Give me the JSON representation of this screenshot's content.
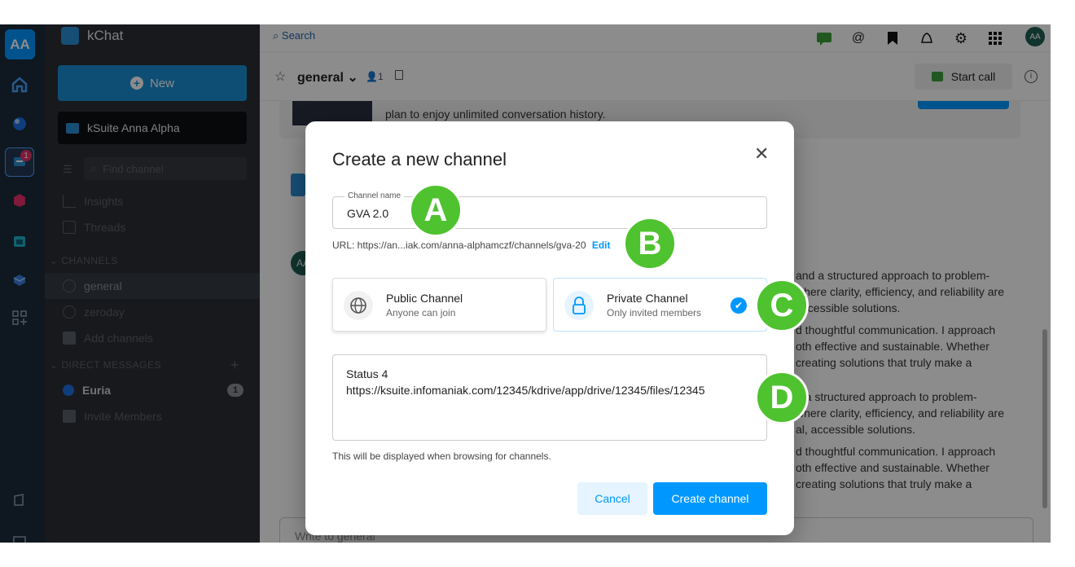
{
  "rail": {
    "avatar": "AA",
    "kchat_badge": "1"
  },
  "sidebar": {
    "app_name": "kChat",
    "new_label": "New",
    "workspace": "kSuite Anna Alpha",
    "find_placeholder": "Find channel",
    "insights": "Insights",
    "threads": "Threads",
    "channels_header": "CHANNELS",
    "channels": [
      "general",
      "zeroday"
    ],
    "add_channels": "Add channels",
    "dm_header": "DIRECT MESSAGES",
    "dm_user": "Euria",
    "dm_badge": "1",
    "invite": "Invite Members"
  },
  "header": {
    "search_placeholder": "Search",
    "avatar": "AA",
    "channel": "general",
    "member_count": "1",
    "start_call": "Start call"
  },
  "main": {
    "banner_text": "plan to enjoy unlimited conversation history.",
    "msg_avatar": "AA",
    "lines": [
      "and a structured approach to problem-",
      "where clarity, efficiency, and reliability are",
      "accessible solutions.",
      "d thoughtful communication. I approach",
      "oth effective and sustainable. Whether",
      "creating solutions that truly make a",
      "d a structured approach to problem-",
      "where clarity, efficiency, and reliability are",
      "al, accessible solutions.",
      "d thoughtful communication. I approach",
      "oth effective and sustainable. Whether",
      "creating solutions that truly make a"
    ],
    "composer_placeholder": "Write to general"
  },
  "modal": {
    "title": "Create a new channel",
    "name_label": "Channel name",
    "name_value": "GVA 2.0",
    "url_text": "URL: https://an...iak.com/anna-alphamczf/channels/gva-20",
    "url_edit": "Edit",
    "public_title": "Public Channel",
    "public_sub": "Anyone can join",
    "private_title": "Private Channel",
    "private_sub": "Only invited members",
    "purpose_line1": "Status 4",
    "purpose_line2": "https://ksuite.infomaniak.com/12345/kdrive/app/drive/12345/files/12345",
    "helper": "This will be displayed when browsing for channels.",
    "cancel": "Cancel",
    "create": "Create channel"
  },
  "callouts": [
    "A",
    "B",
    "C",
    "D"
  ],
  "colors": {
    "accent": "#0098ff",
    "callout": "#4fc22f",
    "sidebar": "#2b2f36",
    "rail": "#1d2b3b"
  }
}
